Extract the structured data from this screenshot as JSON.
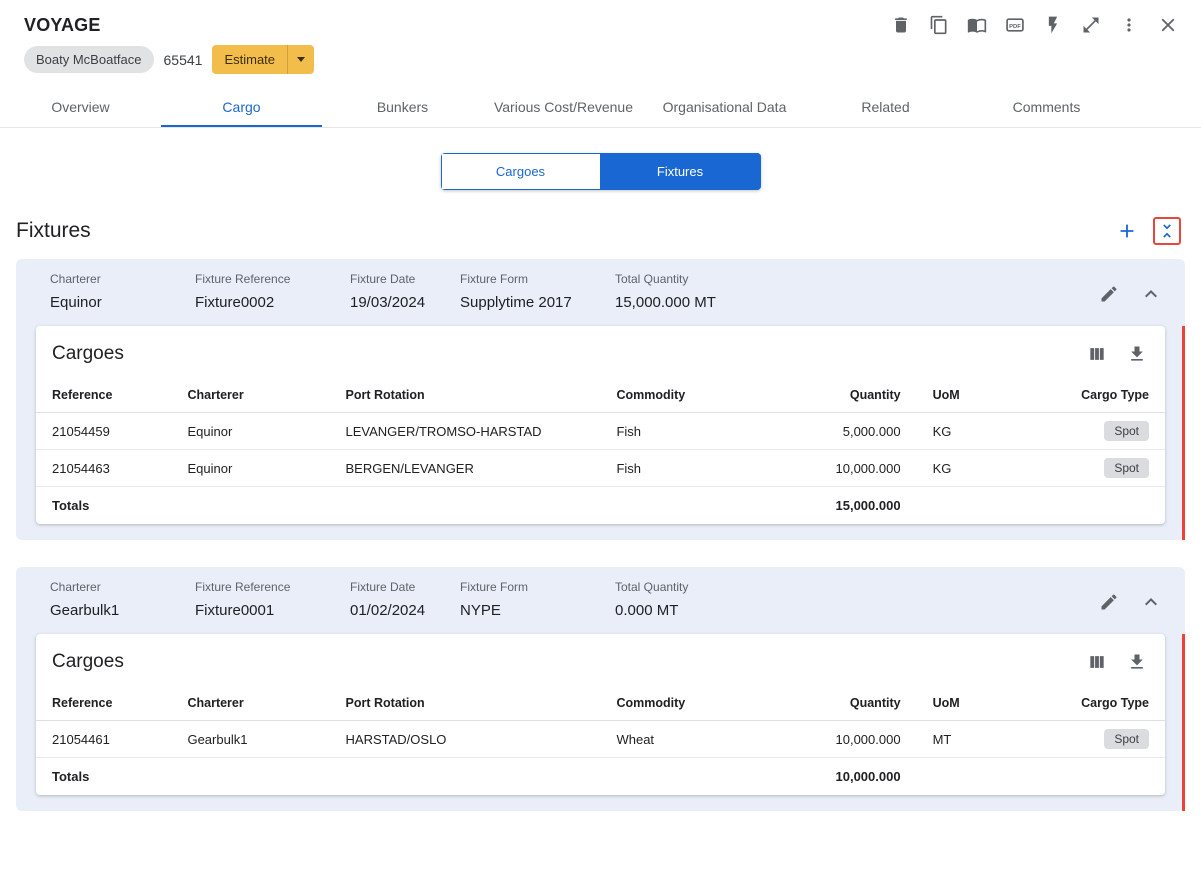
{
  "header": {
    "title": "VOYAGE",
    "vessel_name": "Boaty McBoatface",
    "voyage_number": "65541",
    "estimate_label": "Estimate",
    "action_icons": [
      "delete-icon",
      "copy-icon",
      "book-icon",
      "pdf-icon",
      "bolt-icon",
      "expand-icon",
      "more-icon",
      "close-icon"
    ]
  },
  "tabs": [
    {
      "label": "Overview",
      "active": false
    },
    {
      "label": "Cargo",
      "active": true
    },
    {
      "label": "Bunkers",
      "active": false
    },
    {
      "label": "Various Cost/Revenue",
      "active": false
    },
    {
      "label": "Organisational Data",
      "active": false
    },
    {
      "label": "Related",
      "active": false
    },
    {
      "label": "Comments",
      "active": false
    }
  ],
  "view_toggle": {
    "options": [
      "Cargoes",
      "Fixtures"
    ],
    "selected": "Fixtures"
  },
  "fixtures_section": {
    "title": "Fixtures",
    "action_icons": [
      "add-icon",
      "collapse-all-icon"
    ]
  },
  "colors": {
    "primary_blue": "#1967d2",
    "estimate_amber": "#f2bd4a",
    "card_header_blue": "#e9eef8",
    "highlight_red": "#e8463a",
    "accent_bar_red": "#ef4136"
  },
  "fixtures": [
    {
      "fields": [
        {
          "label": "Charterer",
          "value": "Equinor"
        },
        {
          "label": "Fixture Reference",
          "value": "Fixture0002"
        },
        {
          "label": "Fixture Date",
          "value": "19/03/2024"
        },
        {
          "label": "Fixture Form",
          "value": "Supplytime 2017"
        },
        {
          "label": "Total Quantity",
          "value": "15,000.000 MT"
        }
      ],
      "cargoes": {
        "title": "Cargoes",
        "columns": [
          "Reference",
          "Charterer",
          "Port Rotation",
          "Commodity",
          "Quantity",
          "UoM",
          "Cargo Type"
        ],
        "rows": [
          {
            "reference": "21054459",
            "charterer": "Equinor",
            "port_rotation": "LEVANGER/TROMSO-HARSTAD",
            "commodity": "Fish",
            "quantity": "5,000.000",
            "uom": "KG",
            "cargo_type": "Spot"
          },
          {
            "reference": "21054463",
            "charterer": "Equinor",
            "port_rotation": "BERGEN/LEVANGER",
            "commodity": "Fish",
            "quantity": "10,000.000",
            "uom": "KG",
            "cargo_type": "Spot"
          }
        ],
        "totals": {
          "label": "Totals",
          "quantity": "15,000.000"
        }
      }
    },
    {
      "fields": [
        {
          "label": "Charterer",
          "value": "Gearbulk1"
        },
        {
          "label": "Fixture Reference",
          "value": "Fixture0001"
        },
        {
          "label": "Fixture Date",
          "value": "01/02/2024"
        },
        {
          "label": "Fixture Form",
          "value": "NYPE"
        },
        {
          "label": "Total Quantity",
          "value": "0.000 MT"
        }
      ],
      "cargoes": {
        "title": "Cargoes",
        "columns": [
          "Reference",
          "Charterer",
          "Port Rotation",
          "Commodity",
          "Quantity",
          "UoM",
          "Cargo Type"
        ],
        "rows": [
          {
            "reference": "21054461",
            "charterer": "Gearbulk1",
            "port_rotation": "HARSTAD/OSLO",
            "commodity": "Wheat",
            "quantity": "10,000.000",
            "uom": "MT",
            "cargo_type": "Spot"
          }
        ],
        "totals": {
          "label": "Totals",
          "quantity": "10,000.000"
        }
      }
    }
  ]
}
